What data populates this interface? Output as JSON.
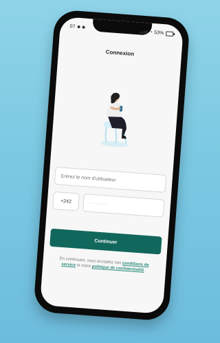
{
  "status_bar": {
    "left_text": "07",
    "right_text": "53%"
  },
  "header": {
    "title": "Connexion"
  },
  "form": {
    "username_placeholder": "Entrez le nom d'utilisateur",
    "country_code": "+242",
    "phone_placeholder": "·· ··· ····",
    "continue_label": "Continuer"
  },
  "terms": {
    "text_1": "En continuant, vous acceptez nos ",
    "terms_link": "conditions de service",
    "text_2": " et notre ",
    "privacy_link": "politique de confidentialité",
    "text_3": "."
  },
  "colors": {
    "primary": "#11675b",
    "background_gradient_top": "#8fd3e8",
    "background_gradient_bottom": "#6dbcdd"
  },
  "icons": {
    "status_icons": [
      "notification-icon",
      "signal-icon",
      "wifi-icon",
      "battery-icon"
    ]
  }
}
